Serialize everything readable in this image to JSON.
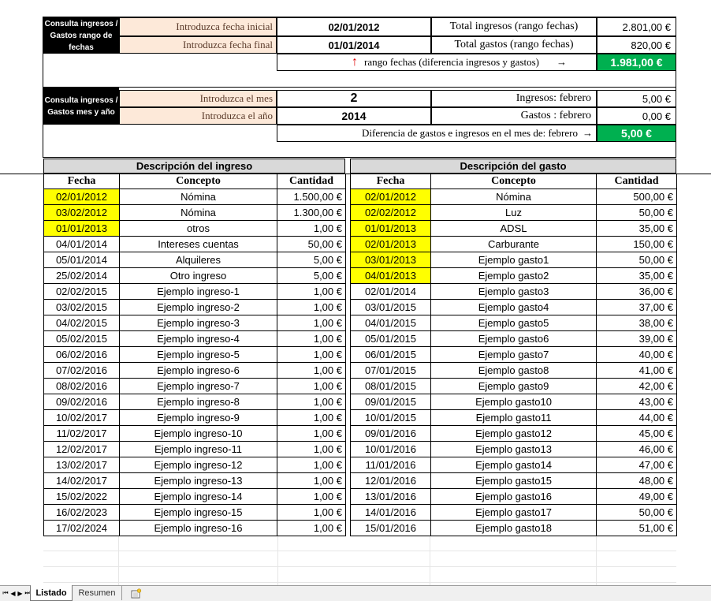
{
  "range_query": {
    "label": "Consulta ingresos / Gastos rango de fechas",
    "start_prompt": "Introduzca fecha inicial",
    "start_value": "02/01/2012",
    "end_prompt": "Introduzca fecha final",
    "end_value": "01/01/2014",
    "income_label": "Total ingresos (rango fechas)",
    "income_value": "2.801,00 €",
    "expense_label": "Total gastos (rango fechas)",
    "expense_value": "820,00 €",
    "diff_up_arrow": "↑",
    "diff_label": "rango fechas (diferencia ingresos y gastos)",
    "diff_arrow": "→",
    "diff_value": "1.981,00 €"
  },
  "month_query": {
    "label": "Consulta ingresos / Gastos mes y año",
    "month_prompt": "Introduzca el mes",
    "month_value": "2",
    "year_prompt": "Introduzca el año",
    "year_value": "2014",
    "income_label": "Ingresos: febrero",
    "income_value": "5,00 €",
    "expense_label": "Gastos : febrero",
    "expense_value": "0,00 €",
    "diff_label": "Diferencia de gastos e ingresos en el mes de:  febrero",
    "diff_arrow": "→",
    "diff_value": "5,00 €"
  },
  "income": {
    "title": "Descripción del ingreso",
    "headers": [
      "Fecha",
      "Concepto",
      "Cantidad"
    ],
    "rows": [
      [
        "02/01/2012",
        "Nómina",
        "1.500,00 €",
        true
      ],
      [
        "03/02/2012",
        "Nómina",
        "1.300,00 €",
        true
      ],
      [
        "01/01/2013",
        "otros",
        "1,00 €",
        true
      ],
      [
        "04/01/2014",
        "Intereses cuentas",
        "50,00 €",
        false
      ],
      [
        "05/01/2014",
        "Alquileres",
        "5,00 €",
        false
      ],
      [
        "25/02/2014",
        "Otro ingreso",
        "5,00 €",
        false
      ],
      [
        "02/02/2015",
        "Ejemplo ingreso-1",
        "1,00 €",
        false
      ],
      [
        "03/02/2015",
        "Ejemplo ingreso-2",
        "1,00 €",
        false
      ],
      [
        "04/02/2015",
        "Ejemplo ingreso-3",
        "1,00 €",
        false
      ],
      [
        "05/02/2015",
        "Ejemplo ingreso-4",
        "1,00 €",
        false
      ],
      [
        "06/02/2016",
        "Ejemplo ingreso-5",
        "1,00 €",
        false
      ],
      [
        "07/02/2016",
        "Ejemplo ingreso-6",
        "1,00 €",
        false
      ],
      [
        "08/02/2016",
        "Ejemplo ingreso-7",
        "1,00 €",
        false
      ],
      [
        "09/02/2016",
        "Ejemplo ingreso-8",
        "1,00 €",
        false
      ],
      [
        "10/02/2017",
        "Ejemplo ingreso-9",
        "1,00 €",
        false
      ],
      [
        "11/02/2017",
        "Ejemplo ingreso-10",
        "1,00 €",
        false
      ],
      [
        "12/02/2017",
        "Ejemplo ingreso-11",
        "1,00 €",
        false
      ],
      [
        "13/02/2017",
        "Ejemplo ingreso-12",
        "1,00 €",
        false
      ],
      [
        "14/02/2017",
        "Ejemplo ingreso-13",
        "1,00 €",
        false
      ],
      [
        "15/02/2022",
        "Ejemplo ingreso-14",
        "1,00 €",
        false
      ],
      [
        "16/02/2023",
        "Ejemplo ingreso-15",
        "1,00 €",
        false
      ],
      [
        "17/02/2024",
        "Ejemplo ingreso-16",
        "1,00 €",
        false
      ]
    ]
  },
  "expense": {
    "title": "Descripción del gasto",
    "headers": [
      "Fecha",
      "Concepto",
      "Cantidad"
    ],
    "rows": [
      [
        "02/01/2012",
        "Nómina",
        "500,00 €",
        true
      ],
      [
        "02/02/2012",
        "Luz",
        "50,00 €",
        true
      ],
      [
        "01/01/2013",
        "ADSL",
        "35,00 €",
        true
      ],
      [
        "02/01/2013",
        "Carburante",
        "150,00 €",
        true
      ],
      [
        "03/01/2013",
        "Ejemplo gasto1",
        "50,00 €",
        true
      ],
      [
        "04/01/2013",
        "Ejemplo gasto2",
        "35,00 €",
        true
      ],
      [
        "02/01/2014",
        "Ejemplo gasto3",
        "36,00 €",
        false
      ],
      [
        "03/01/2015",
        "Ejemplo gasto4",
        "37,00 €",
        false
      ],
      [
        "04/01/2015",
        "Ejemplo gasto5",
        "38,00 €",
        false
      ],
      [
        "05/01/2015",
        "Ejemplo gasto6",
        "39,00 €",
        false
      ],
      [
        "06/01/2015",
        "Ejemplo gasto7",
        "40,00 €",
        false
      ],
      [
        "07/01/2015",
        "Ejemplo gasto8",
        "41,00 €",
        false
      ],
      [
        "08/01/2015",
        "Ejemplo gasto9",
        "42,00 €",
        false
      ],
      [
        "09/01/2015",
        "Ejemplo gasto10",
        "43,00 €",
        false
      ],
      [
        "10/01/2015",
        "Ejemplo gasto11",
        "44,00 €",
        false
      ],
      [
        "09/01/2016",
        "Ejemplo gasto12",
        "45,00 €",
        false
      ],
      [
        "10/01/2016",
        "Ejemplo gasto13",
        "46,00 €",
        false
      ],
      [
        "11/01/2016",
        "Ejemplo gasto14",
        "47,00 €",
        false
      ],
      [
        "12/01/2016",
        "Ejemplo gasto15",
        "48,00 €",
        false
      ],
      [
        "13/01/2016",
        "Ejemplo gasto16",
        "49,00 €",
        false
      ],
      [
        "14/01/2016",
        "Ejemplo gasto17",
        "50,00 €",
        false
      ],
      [
        "15/01/2016",
        "Ejemplo gasto18",
        "51,00 €",
        false
      ]
    ]
  },
  "sheet_tabs": {
    "nav_first": "⏮",
    "nav_prev": "◀",
    "nav_next": "▶",
    "nav_last": "⏭",
    "tabs": [
      "Listado",
      "Resumen"
    ],
    "active": "Listado",
    "new_sheet_icon": "insert-sheet-icon"
  },
  "colors": {
    "accent_green": "#00b050",
    "highlight_yellow": "#ffff00",
    "prompt_peach": "#fde9d9",
    "header_gray": "#d9d9d9",
    "arrow_red": "#e00000"
  }
}
